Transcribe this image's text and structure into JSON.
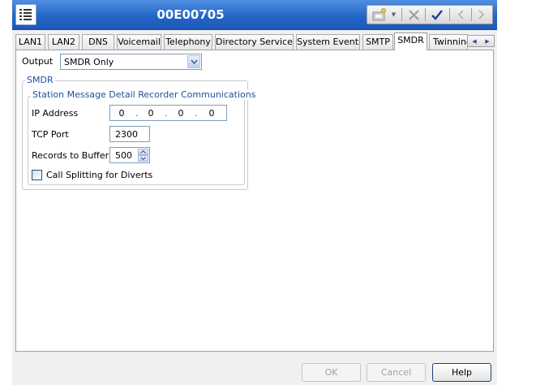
{
  "window": {
    "title": "00E00705"
  },
  "toolbar": {
    "icons": [
      "new-config-icon",
      "dropdown-icon",
      "delete-icon",
      "validate-icon",
      "previous-icon",
      "next-icon"
    ]
  },
  "tabs": [
    {
      "label": "LAN1",
      "active": false
    },
    {
      "label": "LAN2",
      "active": false
    },
    {
      "label": "DNS",
      "active": false
    },
    {
      "label": "Voicemail",
      "active": false
    },
    {
      "label": "Telephony",
      "active": false
    },
    {
      "label": "Directory Services",
      "active": false
    },
    {
      "label": "System Events",
      "active": false
    },
    {
      "label": "SMTP",
      "active": false
    },
    {
      "label": "SMDR",
      "active": true
    },
    {
      "label": "Twinning",
      "active": false
    }
  ],
  "output": {
    "label": "Output",
    "value": "SMDR Only"
  },
  "smdr_group": {
    "title": "SMDR",
    "station_group": {
      "title": "Station Message Detail Recorder Communications",
      "ip_address": {
        "label": "IP Address",
        "octets": [
          "0",
          "0",
          "0",
          "0"
        ]
      },
      "tcp_port": {
        "label": "TCP Port",
        "value": "2300"
      },
      "records_to_buffer": {
        "label": "Records to Buffer",
        "value": "500"
      }
    },
    "call_splitting": {
      "label": "Call Splitting for Diverts",
      "checked": false
    }
  },
  "buttons": {
    "ok": {
      "label": "OK",
      "enabled": false
    },
    "cancel": {
      "label": "Cancel",
      "enabled": false
    },
    "help": {
      "label": "Help",
      "enabled": true
    }
  },
  "colors": {
    "titlebar": "#2466c8",
    "group_title": "#1e4f9e",
    "panel_bg": "#ffffff",
    "window_bg": "#f0f0f0"
  }
}
